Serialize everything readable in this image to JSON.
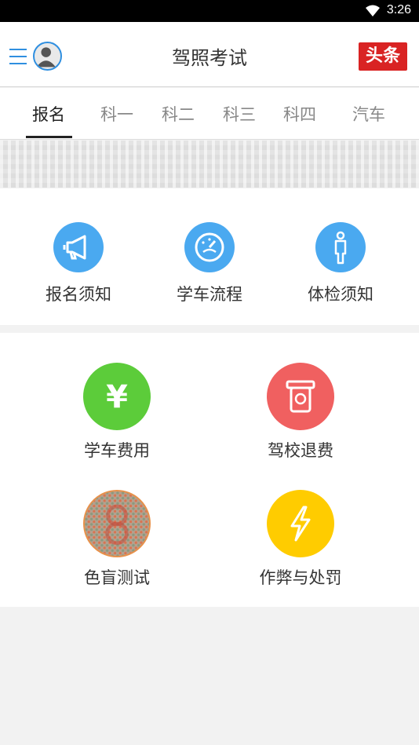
{
  "status_bar": {
    "time": "3:26",
    "wifi_icon": "wifi-icon"
  },
  "app_bar": {
    "title": "驾照考试",
    "badge": "头条",
    "menu_icon": "menu-icon",
    "avatar_icon": "avatar-icon"
  },
  "tabs": [
    {
      "label": "报名",
      "active": true
    },
    {
      "label": "科一",
      "active": false
    },
    {
      "label": "科二",
      "active": false
    },
    {
      "label": "科三",
      "active": false
    },
    {
      "label": "科四",
      "active": false
    },
    {
      "label": "汽车",
      "active": false
    }
  ],
  "section1": {
    "items": [
      {
        "label": "报名须知",
        "icon": "megaphone-icon",
        "color": "#4aa9f0"
      },
      {
        "label": "学车流程",
        "icon": "speedometer-icon",
        "color": "#4aa9f0"
      },
      {
        "label": "体检须知",
        "icon": "person-icon",
        "color": "#4aa9f0"
      }
    ]
  },
  "section2": {
    "items": [
      {
        "label": "学车费用",
        "icon": "yen-icon",
        "color": "#5ccc3a"
      },
      {
        "label": "驾校退费",
        "icon": "refund-card-icon",
        "color": "#f06060"
      },
      {
        "label": "色盲测试",
        "icon": "color-blind-test-icon",
        "color": "#e8914a"
      },
      {
        "label": "作弊与处罚",
        "icon": "lightning-icon",
        "color": "#ffcc00"
      }
    ]
  }
}
